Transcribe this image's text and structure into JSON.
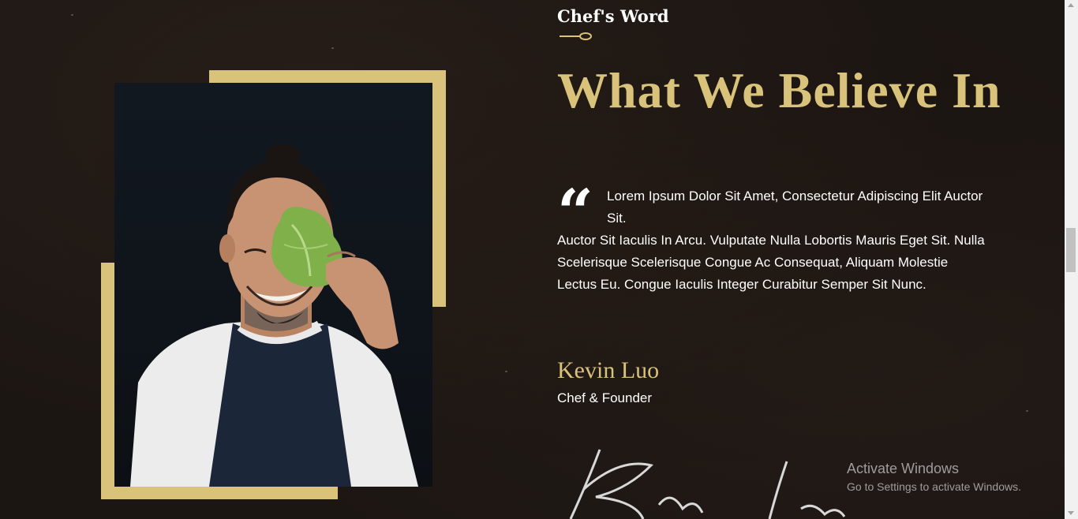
{
  "section": {
    "kicker": "Chef's Word",
    "heading": "What We Believe In",
    "quote_mark": "“",
    "quote_first": "Lorem Ipsum Dolor Sit Amet, Consectetur Adipiscing Elit Auctor Sit.",
    "quote_rest": "Auctor Sit Iaculis In Arcu. Vulputate Nulla Lobortis Mauris Eget Sit. Nulla Scelerisque Scelerisque Congue Ac Consequat, Aliquam Molestie Lectus Eu. Congue Iaculis Integer Curabitur Semper Sit Nunc.",
    "chef_name": "Kevin Luo",
    "chef_role": "Chef & Founder"
  },
  "watermark": {
    "title": "Activate Windows",
    "subtitle": "Go to Settings to activate Windows."
  },
  "icons": {
    "spoon": "spoon-divider-icon",
    "quote": "quote-icon",
    "signature": "signature-image"
  },
  "colors": {
    "accent_gold": "#d9c27a",
    "background": "#1c1613",
    "text": "#ffffff"
  }
}
